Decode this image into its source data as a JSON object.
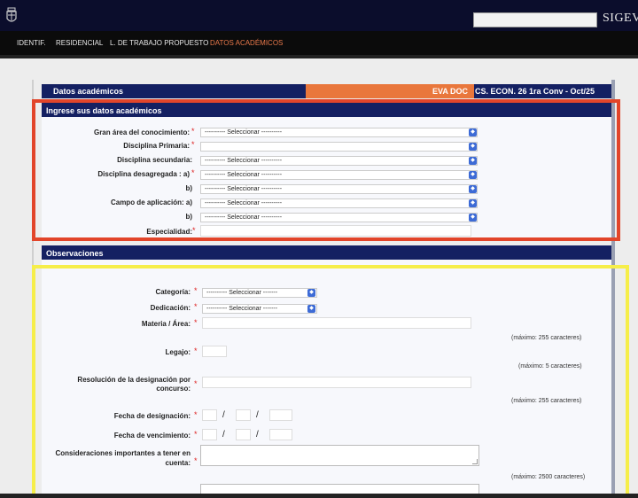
{
  "topbar": {
    "brand": "SIGEVA",
    "search_value": ""
  },
  "nav": {
    "items": [
      {
        "label": "IDENTIF."
      },
      {
        "label": "RESIDENCIAL"
      },
      {
        "label": "L. DE TRABAJO PROPUESTO"
      },
      {
        "label": "DATOS ACADÉMICOS"
      }
    ],
    "active": "DATOS ACADÉMICOS"
  },
  "header": {
    "title": "Datos académicos",
    "eva": "EVA DOC",
    "convocatoria": "CS. ECON. 26 1ra Conv - Oct/25"
  },
  "academic": {
    "section_title": "Ingrese sus datos académicos",
    "fields": [
      {
        "label": "Gran área del conocimiento:",
        "required": "*",
        "value": "---------- Seleccionar ----------"
      },
      {
        "label": "Disciplina Primaria:",
        "required": "*",
        "value": ""
      },
      {
        "label": "Disciplina secundaria:",
        "required": "",
        "value": "---------- Seleccionar ----------"
      },
      {
        "label": "Disciplina desagregada : a)",
        "required": "*",
        "value": "---------- Seleccionar ----------"
      },
      {
        "label": "b)",
        "required": "",
        "value": "---------- Seleccionar ----------"
      },
      {
        "label": "Campo de aplicación: a)",
        "required": "",
        "value": "---------- Seleccionar ----------"
      },
      {
        "label": "b)",
        "required": "",
        "value": "---------- Seleccionar ----------"
      },
      {
        "label": "Especialidad:",
        "required": "*",
        "value": ""
      }
    ]
  },
  "observaciones": {
    "section_title": "Observaciones",
    "categoria": {
      "label": "Categoría:",
      "required": "*",
      "value": "---------- Seleccionar -------"
    },
    "dedicacion": {
      "label": "Dedicación:",
      "required": "*",
      "value": "---------- Seleccionar -------"
    },
    "materia": {
      "label": "Materia / Área:",
      "required": "*",
      "hint": "(máximo: 255 caracteres)"
    },
    "legajo": {
      "label": "Legajo:",
      "required": "*",
      "hint": "(máximo: 5 caracteres)"
    },
    "resolucion": {
      "label_line1": "Resolución de la designación por",
      "label_line2": "concurso:",
      "required": "*",
      "hint": "(máximo: 255 caracteres)"
    },
    "fecha_designacion": {
      "label": "Fecha de designación:",
      "required": "*",
      "sep": "/"
    },
    "fecha_vencimiento": {
      "label": "Fecha de vencimiento:",
      "required": "*",
      "sep": "/"
    },
    "consideraciones": {
      "label_line1": "Consideraciones importantes a tener en",
      "label_line2": "cuenta:",
      "required": "*",
      "hint": "(máximo: 2500 caracteres)"
    }
  },
  "icons": {
    "logo": "crest-icon",
    "select": "select-arrows-icon"
  },
  "colors": {
    "navy": "#142062",
    "accent_orange": "#e9773c",
    "required_red": "#d22222",
    "annotation_red": "#e2452a",
    "annotation_yellow": "#f6ee4a"
  }
}
